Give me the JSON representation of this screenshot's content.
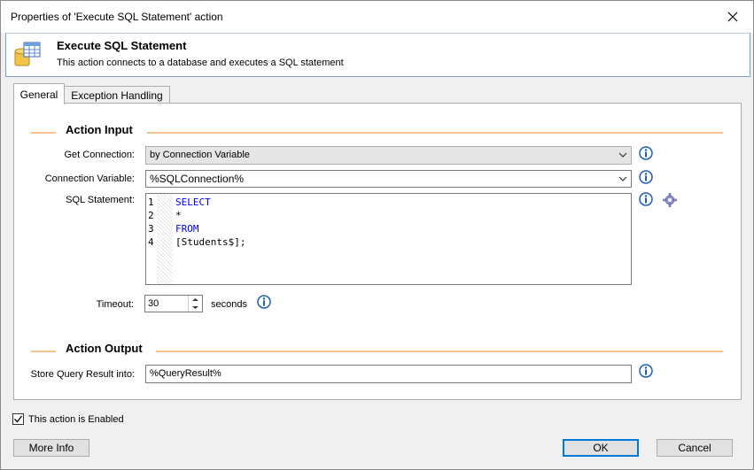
{
  "window": {
    "title": "Properties of 'Execute SQL Statement' action"
  },
  "header": {
    "title": "Execute SQL Statement",
    "subtitle": "This action connects to a database and executes a SQL statement"
  },
  "tabs": [
    {
      "label": "General",
      "active": true
    },
    {
      "label": "Exception Handling",
      "active": false
    }
  ],
  "action_input": {
    "heading": "Action Input",
    "get_connection": {
      "label": "Get Connection:",
      "value": "by Connection Variable"
    },
    "connection_variable": {
      "label": "Connection Variable:",
      "value": "%SQLConnection%"
    },
    "sql_statement": {
      "label": "SQL Statement:",
      "lines": [
        {
          "num": "1",
          "text": "SELECT",
          "keyword": true
        },
        {
          "num": "2",
          "text": "*",
          "keyword": false
        },
        {
          "num": "3",
          "text": "FROM",
          "keyword": true
        },
        {
          "num": "4",
          "text": "[Students$];",
          "keyword": false
        }
      ]
    },
    "timeout": {
      "label": "Timeout:",
      "value": "30",
      "unit": "seconds"
    }
  },
  "action_output": {
    "heading": "Action Output",
    "store_result": {
      "label": "Store Query Result into:",
      "value": "%QueryResult%"
    }
  },
  "enabled_checkbox": {
    "label": "This action is Enabled",
    "checked": true
  },
  "buttons": {
    "more_info": "More Info",
    "ok": "OK",
    "cancel": "Cancel"
  },
  "colors": {
    "accent": "#0078d7",
    "section_line": "#f5c18c",
    "keyword": "#0000ff",
    "info_blue": "#1e5fb4"
  }
}
